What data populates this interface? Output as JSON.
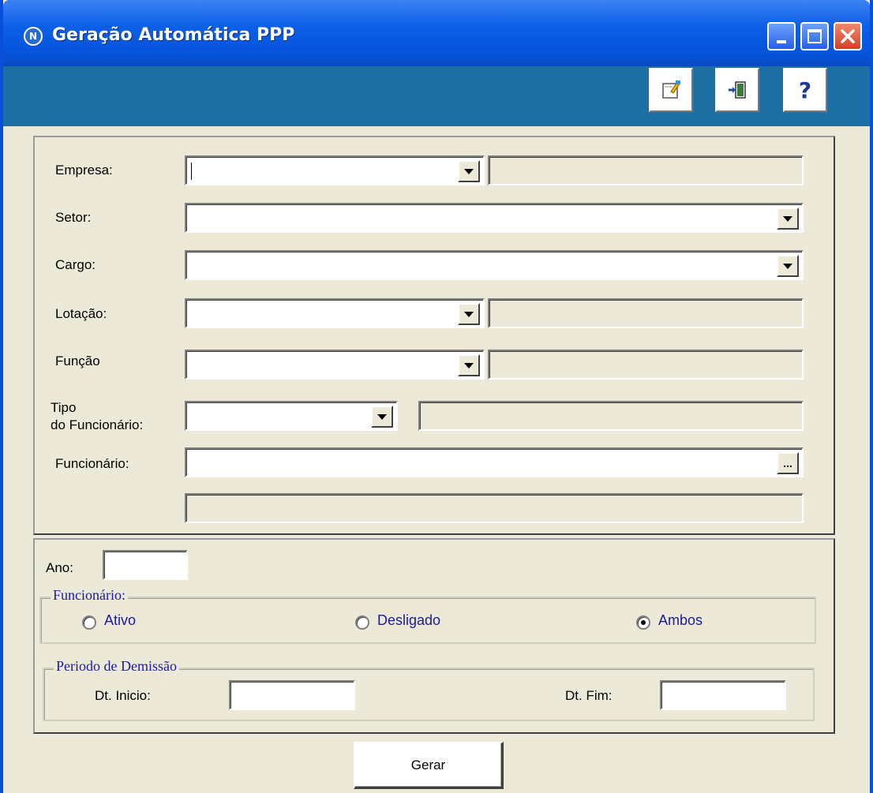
{
  "window": {
    "title": "Geração Automática PPP",
    "app_icon_letter": "N"
  },
  "toolbar": {
    "buttons": [
      {
        "name": "edit-icon"
      },
      {
        "name": "exit-icon"
      },
      {
        "name": "help-icon",
        "glyph": "?"
      }
    ]
  },
  "form": {
    "empresa_label": "Empresa:",
    "setor_label": "Setor:",
    "cargo_label": "Cargo:",
    "lotacao_label": "Lotação:",
    "funcao_label": "Função",
    "tipo_label_line1": "Tipo",
    "tipo_label_line2": "do Funcionário:",
    "funcionario_label": "Funcionário:",
    "lookup_button": "..."
  },
  "filters": {
    "ano_label": "Ano:",
    "funcionario_group_label": "Funcionário:",
    "options": [
      "Ativo",
      "Desligado",
      "Ambos"
    ],
    "selected": "Ambos",
    "periodo_group_label": "Periodo de Demissão",
    "dt_inicio_label": "Dt. Inicio:",
    "dt_fim_label": "Dt. Fim:"
  },
  "actions": {
    "gerar_label": "Gerar"
  },
  "colors": {
    "titlebar": "#0553dc",
    "toolbar": "#1e6fa3",
    "panel": "#ece9d8",
    "radio_text": "#1a1aa0"
  }
}
